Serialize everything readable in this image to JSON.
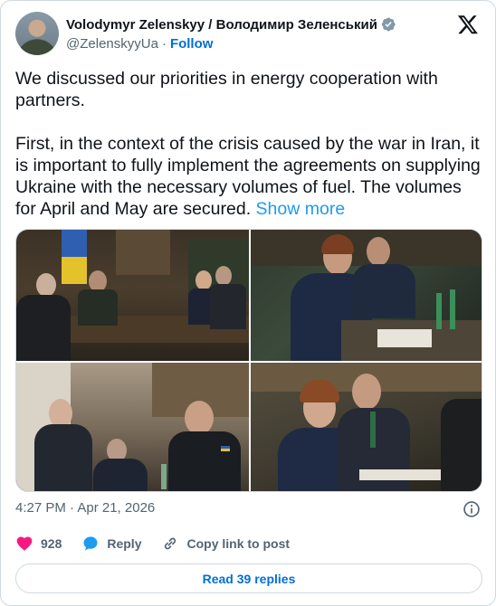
{
  "author": {
    "display_name": "Volodymyr Zelenskyy / Володимир Зеленський",
    "handle": "@ZelenskyyUa",
    "separator": "·",
    "follow_label": "Follow",
    "verified_color": "#829aab"
  },
  "tweet": {
    "text": "We discussed our priorities in energy cooperation with partners.\n\nFirst, in the context of the crisis caused by the war in Iran, it is important to fully implement the agreements on supplying Ukraine with the necessary volumes of fuel. The volumes for April and May are secured. ",
    "show_more": "Show more"
  },
  "media": {
    "count": 4
  },
  "meta": {
    "timestamp": "4:27 PM · Apr 21, 2026"
  },
  "actions": {
    "likes": "928",
    "reply_label": "Reply",
    "copy_link_label": "Copy link to post"
  },
  "footer": {
    "read_replies": "Read 39 replies"
  },
  "colors": {
    "like": "#f91880",
    "link": "#1d9bf0",
    "follow": "#006fd6",
    "secondary_text": "#536471",
    "border": "#cfd9de"
  }
}
